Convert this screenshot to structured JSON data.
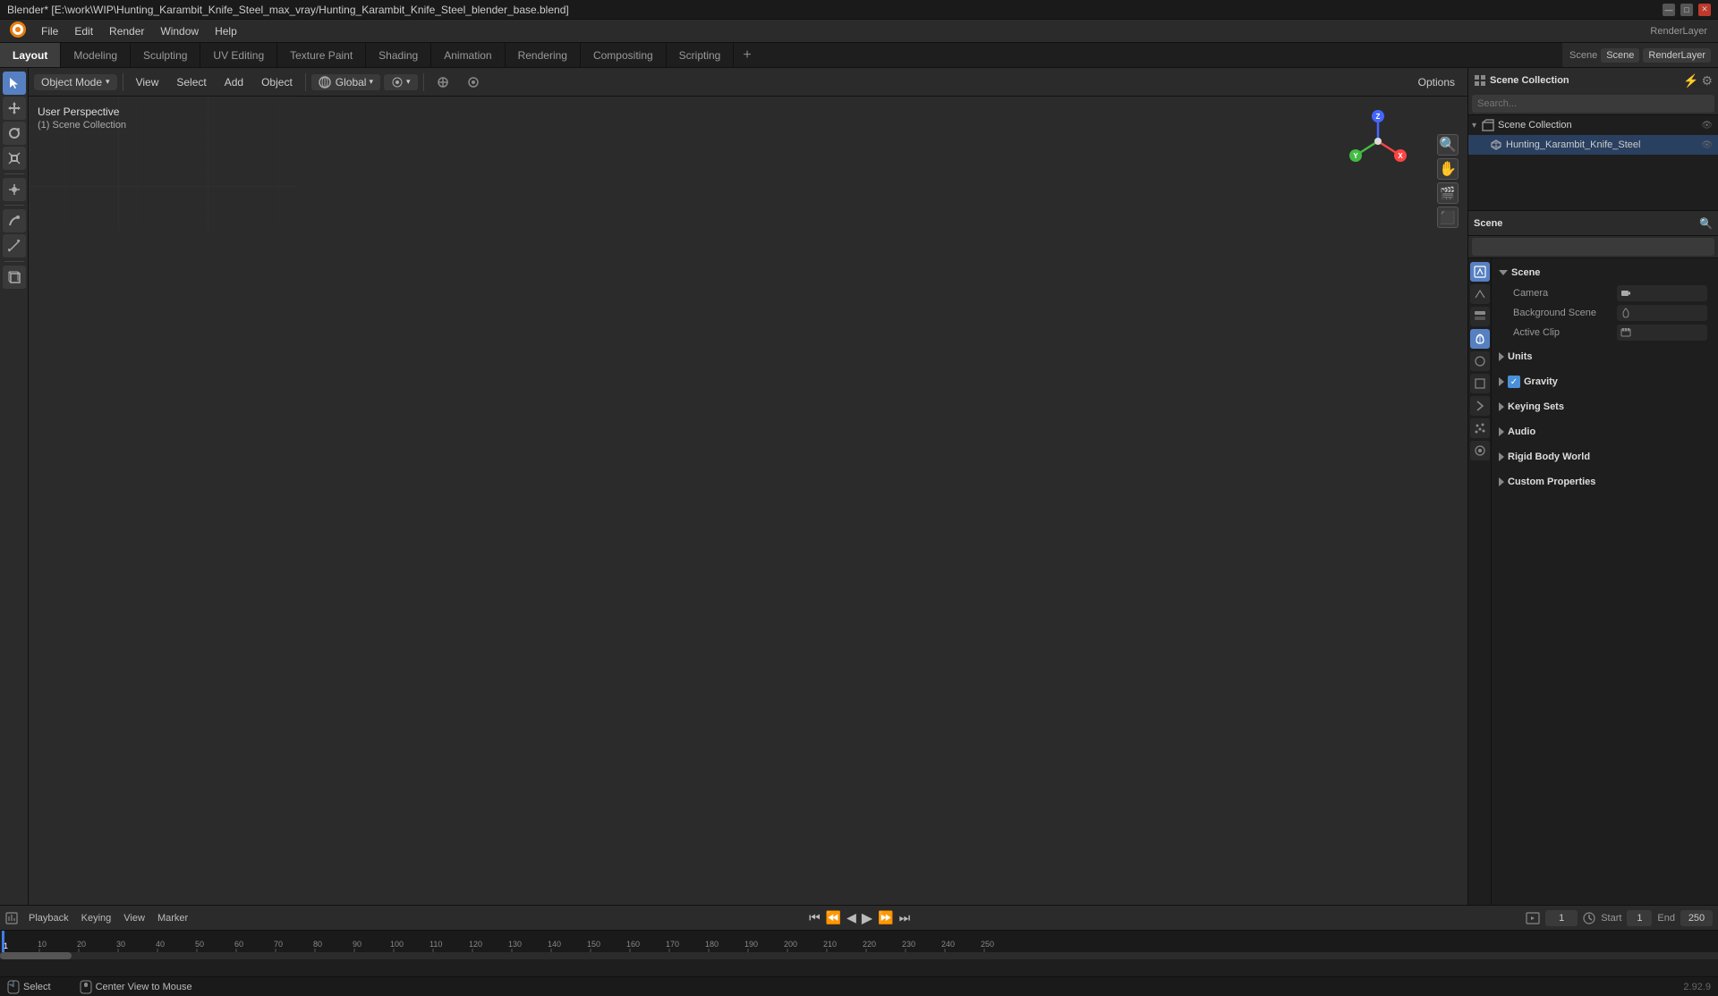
{
  "titlebar": {
    "title": "Blender* [E:\\work\\WIP\\Hunting_Karambit_Knife_Steel_max_vray/Hunting_Karambit_Knife_Steel_blender_base.blend]",
    "controls": [
      "—",
      "□",
      "✕"
    ]
  },
  "menubar": {
    "items": [
      "Blender",
      "File",
      "Edit",
      "Render",
      "Window",
      "Help"
    ]
  },
  "workspace_tabs": {
    "tabs": [
      "Layout",
      "Modeling",
      "Sculpting",
      "UV Editing",
      "Texture Paint",
      "Shading",
      "Animation",
      "Rendering",
      "Compositing",
      "Scripting"
    ],
    "active": "Layout",
    "add_label": "+"
  },
  "viewport": {
    "mode": "Object Mode",
    "perspective": "User Perspective",
    "scene_info": "(1) Scene Collection",
    "header_items": [
      "View",
      "Select",
      "Add",
      "Object"
    ],
    "transform_space": "Global",
    "snap_label": ""
  },
  "gizmo": {
    "x_label": "X",
    "y_label": "Y",
    "z_label": "Z"
  },
  "outliner": {
    "title": "Scene Collection",
    "search_placeholder": "",
    "items": [
      {
        "name": "Hunting_Karambit_Knife_Steel",
        "icon": "📁",
        "indent": 0
      }
    ]
  },
  "properties": {
    "title": "Scene",
    "icons": [
      "🎬",
      "🌍",
      "🎭",
      "💡",
      "📷",
      "🎞",
      "🔧",
      "✨",
      "🖥"
    ],
    "active_icon": 0,
    "scene_label": "Scene",
    "sections": [
      {
        "name": "Scene",
        "label": "Scene",
        "expanded": true,
        "rows": [
          {
            "label": "Camera",
            "value": ""
          },
          {
            "label": "Background Scene",
            "value": ""
          },
          {
            "label": "Active Clip",
            "value": ""
          }
        ]
      },
      {
        "name": "Units",
        "label": "Units",
        "expanded": false,
        "rows": []
      },
      {
        "name": "Gravity",
        "label": "Gravity",
        "expanded": false,
        "has_checkbox": true,
        "checked": true,
        "rows": []
      },
      {
        "name": "Keying Sets",
        "label": "Keying Sets",
        "expanded": false,
        "rows": []
      },
      {
        "name": "Audio",
        "label": "Audio",
        "expanded": false,
        "rows": []
      },
      {
        "name": "Rigid Body World",
        "label": "Rigid Body World",
        "expanded": false,
        "rows": []
      },
      {
        "name": "Custom Properties",
        "label": "Custom Properties",
        "expanded": false,
        "rows": []
      }
    ]
  },
  "timeline": {
    "playback_label": "Playback",
    "keying_label": "Keying",
    "view_label": "View",
    "marker_label": "Marker",
    "frame_current": "1",
    "start_label": "Start",
    "start_value": "1",
    "end_label": "End",
    "end_value": "250",
    "frame_markers": [
      "1",
      "50",
      "100",
      "150",
      "200",
      "250"
    ],
    "ruler_ticks": [
      1,
      10,
      20,
      30,
      40,
      50,
      60,
      70,
      80,
      90,
      100,
      110,
      120,
      130,
      140,
      150,
      160,
      170,
      180,
      190,
      200,
      210,
      220,
      230,
      240,
      250
    ]
  },
  "status_bar": {
    "left": "Select",
    "center": "Center View to Mouse",
    "right": "2.92.9"
  },
  "options_label": "Options"
}
